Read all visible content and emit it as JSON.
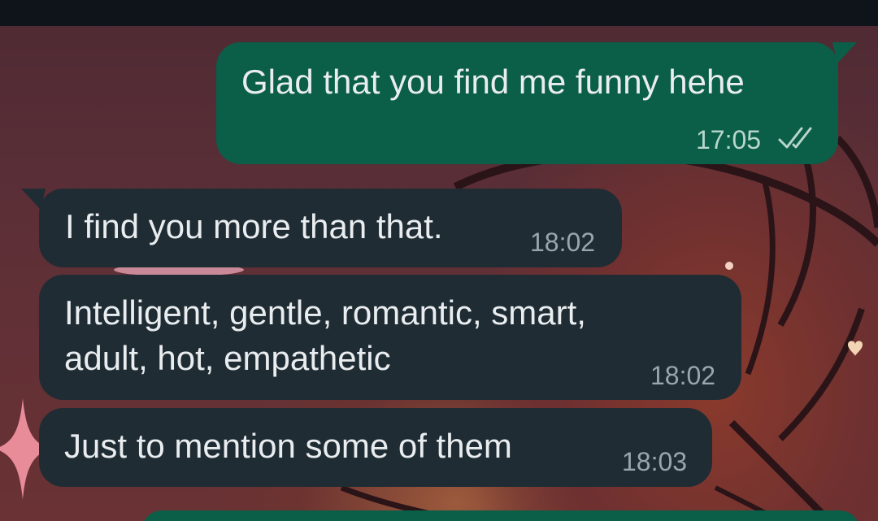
{
  "chat": {
    "messages": [
      {
        "direction": "outgoing",
        "text": "Glad that you find me funny hehe",
        "time": "17:05",
        "status": "read",
        "status_icon": "double-check-icon"
      },
      {
        "direction": "incoming",
        "text": "I find you more than that.",
        "time": "18:02"
      },
      {
        "direction": "incoming",
        "lines": [
          "Intelligent, gentle, romantic, smart,",
          "adult, hot, empathetic"
        ],
        "time": "18:02"
      },
      {
        "direction": "incoming",
        "text": "Just to mention some of them",
        "time": "18:03"
      }
    ]
  },
  "colors": {
    "outgoing_bubble": "#0b5e47",
    "incoming_bubble": "#1f2c34",
    "top_bar": "#0e1419",
    "text": "#e9edef"
  }
}
